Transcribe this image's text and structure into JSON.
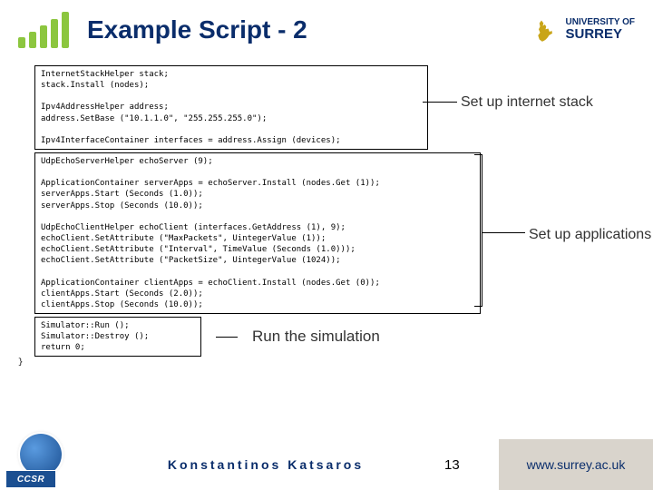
{
  "header": {
    "title": "Example Script - 2",
    "university_line1": "UNIVERSITY OF",
    "university_line2": "SURREY"
  },
  "code": {
    "block1": "InternetStackHelper stack;\nstack.Install (nodes);\n\nIpv4AddressHelper address;\naddress.SetBase (\"10.1.1.0\", \"255.255.255.0\");\n\nIpv4InterfaceContainer interfaces = address.Assign (devices);",
    "block2": "UdpEchoServerHelper echoServer (9);\n\nApplicationContainer serverApps = echoServer.Install (nodes.Get (1));\nserverApps.Start (Seconds (1.0));\nserverApps.Stop (Seconds (10.0));\n\nUdpEchoClientHelper echoClient (interfaces.GetAddress (1), 9);\nechoClient.SetAttribute (\"MaxPackets\", UintegerValue (1));\nechoClient.SetAttribute (\"Interval\", TimeValue (Seconds (1.0)));\nechoClient.SetAttribute (\"PacketSize\", UintegerValue (1024));\n\nApplicationContainer clientApps = echoClient.Install (nodes.Get (0));\nclientApps.Start (Seconds (2.0));\nclientApps.Stop (Seconds (10.0));",
    "block3": "Simulator::Run ();\nSimulator::Destroy ();\nreturn 0;",
    "closing": "}"
  },
  "annotations": {
    "stack": "Set up internet stack",
    "apps": "Set up applications",
    "run": "Run the simulation"
  },
  "footer": {
    "author": "Konstantinos Katsaros",
    "page": "13",
    "url": "www.surrey.ac.uk",
    "ccsr": "CCSR"
  }
}
